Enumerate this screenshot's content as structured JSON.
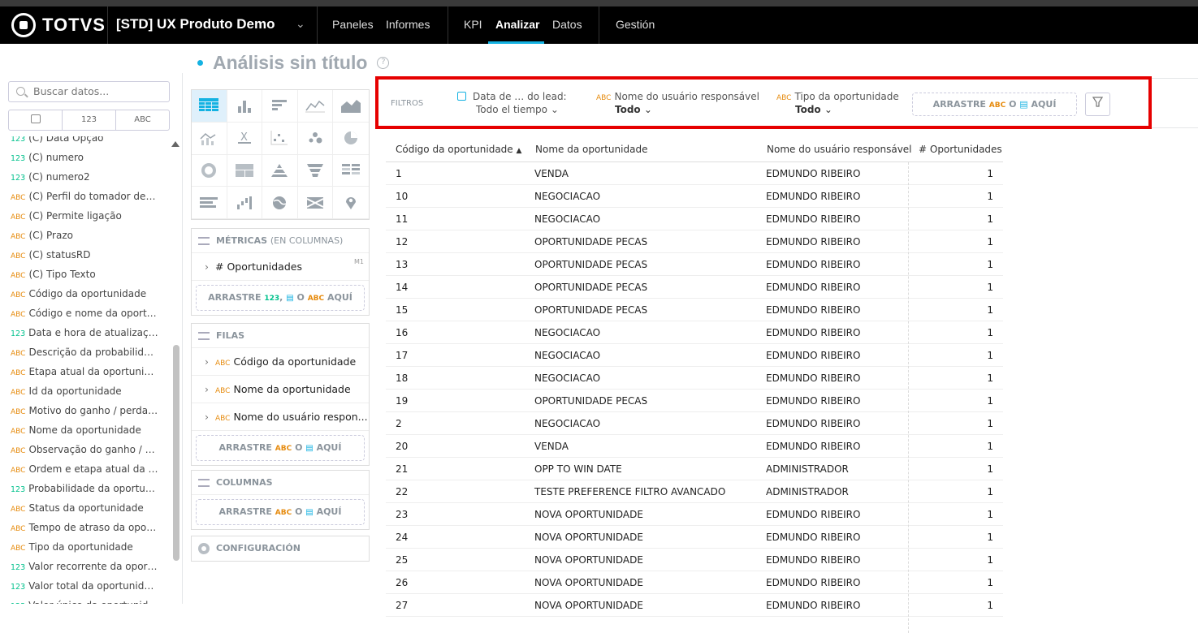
{
  "header": {
    "logo_text": "TOTVS",
    "workspace": "[STD] UX Produto Demo",
    "nav": [
      "Paneles",
      "Informes",
      "KPI",
      "Analizar",
      "Datos",
      "Gestión"
    ],
    "active_nav": "Analizar"
  },
  "report": {
    "title": "Análisis sin título",
    "help_symbol": "?"
  },
  "data_panel": {
    "search_placeholder": "Buscar datos...",
    "type_tabs": [
      "",
      "123",
      "ABC"
    ],
    "fields": [
      {
        "t": "123",
        "n": "(C) Data Opção"
      },
      {
        "t": "123",
        "n": "(C) numero"
      },
      {
        "t": "123",
        "n": "(C) numero2"
      },
      {
        "t": "ABC",
        "n": "(C) Perfil do tomador de d..."
      },
      {
        "t": "ABC",
        "n": "(C) Permite ligação"
      },
      {
        "t": "ABC",
        "n": "(C) Prazo"
      },
      {
        "t": "ABC",
        "n": "(C) statusRD"
      },
      {
        "t": "ABC",
        "n": "(C) Tipo Texto"
      },
      {
        "t": "ABC",
        "n": "Código da oportunidade"
      },
      {
        "t": "ABC",
        "n": "Código e nome da oportu..."
      },
      {
        "t": "123",
        "n": "Data e hora de atualizaçã..."
      },
      {
        "t": "ABC",
        "n": "Descrição da probabilidad..."
      },
      {
        "t": "ABC",
        "n": "Etapa atual da oportunidade"
      },
      {
        "t": "ABC",
        "n": "Id da oportunidade"
      },
      {
        "t": "ABC",
        "n": "Motivo do ganho / perda ..."
      },
      {
        "t": "ABC",
        "n": "Nome da oportunidade"
      },
      {
        "t": "ABC",
        "n": "Observação do ganho / pe..."
      },
      {
        "t": "ABC",
        "n": "Ordem e etapa atual da o..."
      },
      {
        "t": "123",
        "n": "Probabilidade da oportuni..."
      },
      {
        "t": "ABC",
        "n": "Status da oportunidade"
      },
      {
        "t": "ABC",
        "n": "Tempo de atraso da oport..."
      },
      {
        "t": "ABC",
        "n": "Tipo da oportunidade"
      },
      {
        "t": "123",
        "n": "Valor recorrente da oportu..."
      },
      {
        "t": "123",
        "n": "Valor total da oportunidade"
      },
      {
        "t": "123",
        "n": "Valor único da oportunidade"
      }
    ]
  },
  "buckets": {
    "metrics": {
      "title": "MÉTRICAS",
      "subtitle": "(EN COLUMNAS)",
      "items": [
        "# Oportunidades"
      ],
      "item_tag": "M1",
      "drop": [
        "ARRASTRE",
        "123",
        ",",
        "O",
        "ABC",
        "AQUÍ"
      ]
    },
    "rows": {
      "title": "FILAS",
      "items": [
        "Código da oportunidade",
        "Nome da oportunidade",
        "Nome do usuário respon..."
      ],
      "item_type": "ABC",
      "drop": [
        "ARRASTRE",
        "ABC",
        "O",
        "AQUÍ"
      ]
    },
    "columns": {
      "title": "COLUMNAS",
      "drop": [
        "ARRASTRE",
        "ABC",
        "O",
        "AQUÍ"
      ]
    },
    "config": "CONFIGURACIÓN"
  },
  "filters": {
    "label": "FILTROS",
    "items": [
      {
        "name": "Data de … do lead:",
        "value": "Todo el tiempo",
        "type": "date"
      },
      {
        "name": "Nome do usuário responsável",
        "value": "Todo",
        "type": "ABC"
      },
      {
        "name": "Tipo da oportunidade",
        "value": "Todo",
        "type": "ABC"
      }
    ],
    "drop": [
      "ARRASTRE",
      "ABC",
      "O",
      "AQUÍ"
    ]
  },
  "table": {
    "columns": [
      "Código da oportunidade",
      "Nome da oportunidade",
      "Nome do usuário responsável",
      "# Oportunidades"
    ],
    "sort_indicator": "▲",
    "rows": [
      [
        "1",
        "VENDA",
        "EDMUNDO RIBEIRO",
        "1"
      ],
      [
        "10",
        "NEGOCIACAO",
        "EDMUNDO RIBEIRO",
        "1"
      ],
      [
        "11",
        "NEGOCIACAO",
        "EDMUNDO RIBEIRO",
        "1"
      ],
      [
        "12",
        "OPORTUNIDADE PECAS",
        "EDMUNDO RIBEIRO",
        "1"
      ],
      [
        "13",
        "OPORTUNIDADE PECAS",
        "EDMUNDO RIBEIRO",
        "1"
      ],
      [
        "14",
        "OPORTUNIDADE PECAS",
        "EDMUNDO RIBEIRO",
        "1"
      ],
      [
        "15",
        "OPORTUNIDADE PECAS",
        "EDMUNDO RIBEIRO",
        "1"
      ],
      [
        "16",
        "NEGOCIACAO",
        "EDMUNDO RIBEIRO",
        "1"
      ],
      [
        "17",
        "NEGOCIACAO",
        "EDMUNDO RIBEIRO",
        "1"
      ],
      [
        "18",
        "NEGOCIACAO",
        "EDMUNDO RIBEIRO",
        "1"
      ],
      [
        "19",
        "OPORTUNIDADE PECAS",
        "EDMUNDO RIBEIRO",
        "1"
      ],
      [
        "2",
        "NEGOCIACAO",
        "EDMUNDO RIBEIRO",
        "1"
      ],
      [
        "20",
        "VENDA",
        "EDMUNDO RIBEIRO",
        "1"
      ],
      [
        "21",
        "OPP TO WIN DATE",
        "ADMINISTRADOR",
        "1"
      ],
      [
        "22",
        "TESTE PREFERENCE FILTRO AVANCADO",
        "ADMINISTRADOR",
        "1"
      ],
      [
        "23",
        "NOVA OPORTUNIDADE",
        "EDMUNDO RIBEIRO",
        "1"
      ],
      [
        "24",
        "NOVA OPORTUNIDADE",
        "EDMUNDO RIBEIRO",
        "1"
      ],
      [
        "25",
        "NOVA OPORTUNIDADE",
        "EDMUNDO RIBEIRO",
        "1"
      ],
      [
        "26",
        "NOVA OPORTUNIDADE",
        "EDMUNDO RIBEIRO",
        "1"
      ],
      [
        "27",
        "NOVA OPORTUNIDADE",
        "EDMUNDO RIBEIRO",
        "1"
      ]
    ]
  },
  "colors": {
    "accent": "#14b2e2",
    "highlight_box": "#e60000",
    "attribute": "#e68b0e",
    "measure": "#00c18c"
  }
}
